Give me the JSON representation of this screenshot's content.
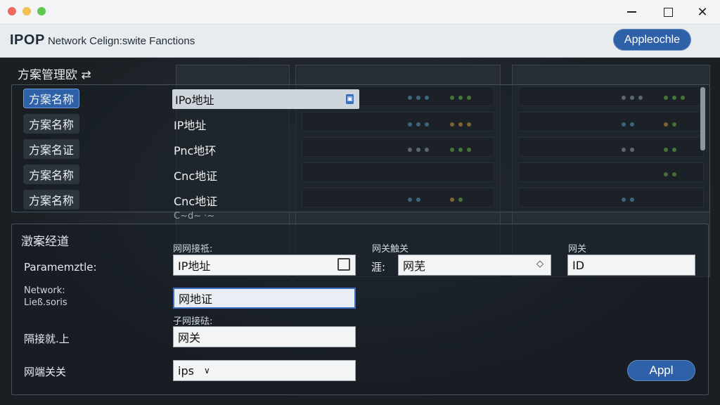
{
  "window": {
    "controls": [
      "—",
      "☐",
      "✕"
    ]
  },
  "header": {
    "title_bold": "IPOP",
    "title_rest": " Network Celign:swite Fanctions",
    "action_button": "Appleochle"
  },
  "schemes": {
    "title": "方案管理欧 ⇄",
    "rows": [
      {
        "name": "方案名称",
        "ip": "IPo地址",
        "selected": true
      },
      {
        "name": "方案名称",
        "ip": "IP地址",
        "selected": false
      },
      {
        "name": "方案名证",
        "ip": "Pnc地环",
        "selected": false
      },
      {
        "name": "方案名称",
        "ip": "Cnc地证",
        "selected": false
      },
      {
        "name": "方案名称",
        "ip": "Cnc地证",
        "selected": false
      }
    ],
    "partial_row": "C~d~ ·~"
  },
  "details": {
    "title": "澂案经道",
    "labels": {
      "parameters": "Paramemztle:",
      "network_line1": "Network:",
      "network_line2": "Ließ.soris",
      "ip_field_label": "网网接祗:",
      "subnet_label": "子网接砝:",
      "gateway_left": "隔接就.上",
      "gateway_bottom": "网端关关",
      "gateway_field_label": "网关触关",
      "gateway_prefix": "涯:",
      "gateway_right_label": "网关"
    },
    "values": {
      "ip_address": "IP地址",
      "network_address": "网地证",
      "gateway": "网关",
      "select_value": "ips",
      "gateway_select": "网芜",
      "gateway_right": "ID"
    },
    "apply_button": "Appl"
  },
  "colors": {
    "accent": "#2f61a8",
    "panel_bg": "#1b2127",
    "header_bg": "#e9ecef"
  }
}
